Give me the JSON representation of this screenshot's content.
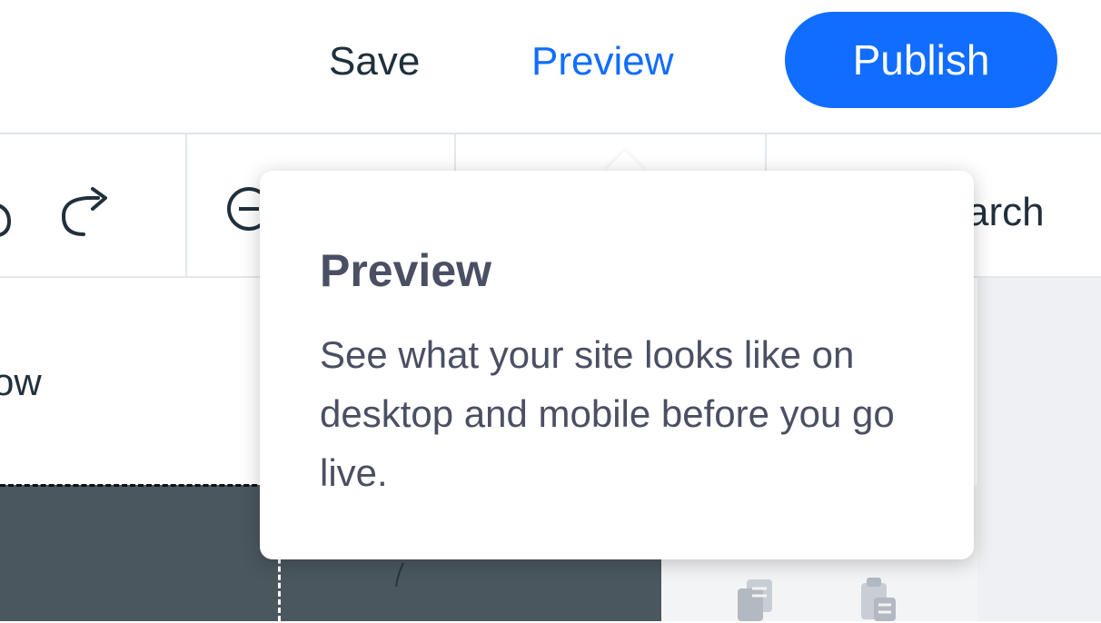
{
  "topbar": {
    "save_label": "Save",
    "preview_label": "Preview",
    "publish_label": "Publish"
  },
  "toolbar": {
    "search_label": "arch"
  },
  "canvas": {
    "partial_text": "ow"
  },
  "tooltip": {
    "title": "Preview",
    "body": "See what your site looks like on desktop and mobile before you go live."
  },
  "colors": {
    "accent": "#116dff",
    "text_dark": "#20303c",
    "tooltip_text": "#4a4f63"
  }
}
